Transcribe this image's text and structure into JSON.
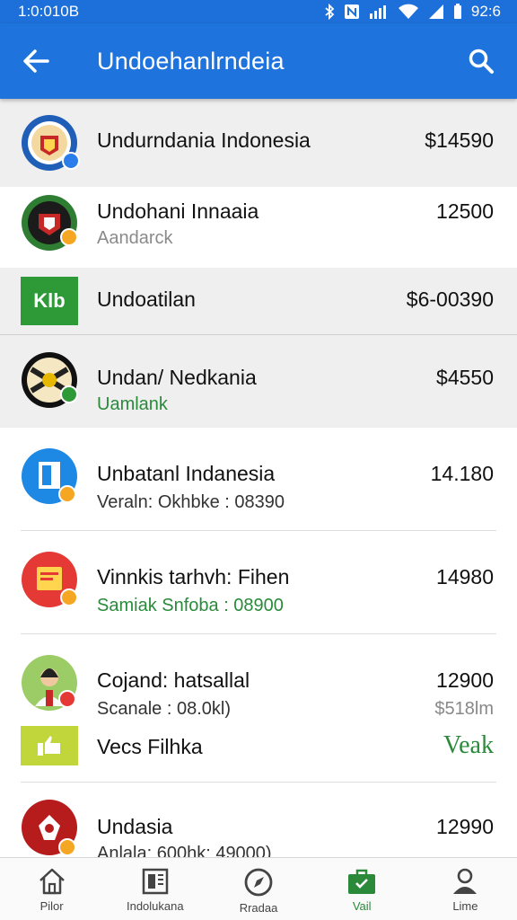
{
  "status_bar": {
    "time": "1:0:010B",
    "clock": "92:6"
  },
  "header": {
    "title": "Undoehanlrndeia"
  },
  "items": [
    {
      "name": "Undurndania Indonesia",
      "value": "$14590"
    },
    {
      "name": "Undohani Innaaia",
      "subtitle": "Aandarck",
      "value": "12500"
    },
    {
      "name": "Undoatilan",
      "value": "$6-00390",
      "logo_text": "Klb"
    },
    {
      "name": "Undan/ Nedkania",
      "subtitle": "Uamlank",
      "value": "$4550"
    },
    {
      "name": "Unbatanl Indanesia",
      "subtitle": "Veraln: Okhbke : 08390",
      "value": "14.180"
    },
    {
      "name": "Vinnkis tarhvh: Fihen",
      "subtitle": "Samiak Snfoba : 08900",
      "value": "14980"
    },
    {
      "name": "Cojand: hatsallal",
      "subtitle": "Scanale : 08.0kl)",
      "value": "12900",
      "subvalue": "$518lm"
    },
    {
      "name": "Vecs Filhka",
      "value": "Veak"
    },
    {
      "name": "Undasia",
      "subtitle": "Anlala: 600hk: 49000)",
      "value": "12990"
    }
  ],
  "nav": [
    {
      "label": "Pilor",
      "icon": "home-icon"
    },
    {
      "label": "Indolukana",
      "icon": "news-icon"
    },
    {
      "label": "Rradaa",
      "icon": "compass-icon"
    },
    {
      "label": "Vail",
      "icon": "briefcase-icon"
    },
    {
      "label": "Lime",
      "icon": "person-icon"
    }
  ],
  "colors": {
    "primary": "#1e73dd",
    "accent_green": "#2a8a3a",
    "badge_orange": "#f5a623"
  }
}
